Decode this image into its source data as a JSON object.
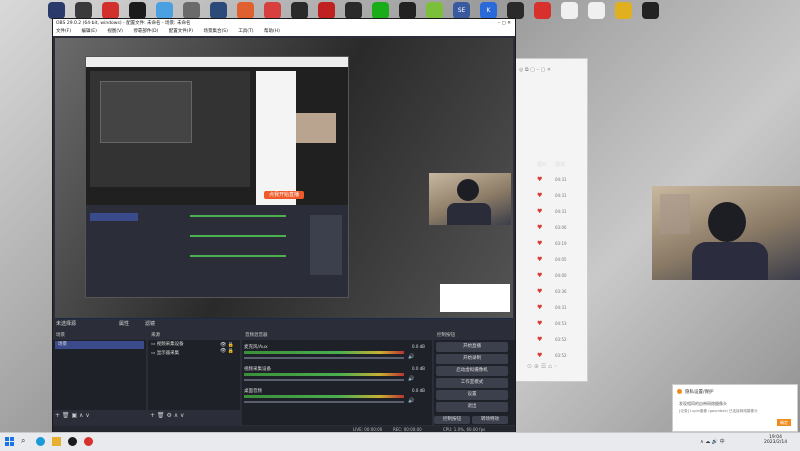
{
  "desktop": {
    "icons": [
      {
        "label": "",
        "color": "#2a3a6a"
      },
      {
        "label": "",
        "color": "#3a3a3a"
      },
      {
        "label": "",
        "color": "#d2302c"
      },
      {
        "label": "",
        "color": "#1b1b1b"
      },
      {
        "label": "",
        "color": "#4aa0e0"
      },
      {
        "label": "",
        "color": "#6a6a6a"
      },
      {
        "label": "",
        "color": "#2b4a7a"
      },
      {
        "label": "",
        "color": "#e06030"
      },
      {
        "label": "",
        "color": "#d84040"
      },
      {
        "label": "",
        "color": "#2a2a2a"
      },
      {
        "label": "",
        "color": "#c02020"
      },
      {
        "label": "",
        "color": "#2a2a2a"
      },
      {
        "label": "",
        "color": "#1aad19"
      },
      {
        "label": "",
        "color": "#222"
      },
      {
        "label": "",
        "color": "#7bbf3b"
      },
      {
        "label": "SE",
        "color": "#3a5aa0"
      },
      {
        "label": "K",
        "color": "#2a6ad8"
      },
      {
        "label": "",
        "color": "#2a2a2a"
      },
      {
        "label": "",
        "color": "#d8302c"
      },
      {
        "label": "",
        "color": "#f0f0f0"
      },
      {
        "label": "",
        "color": "#f0f0f0"
      },
      {
        "label": "",
        "color": "#e0b020"
      },
      {
        "label": "",
        "color": "#222"
      }
    ]
  },
  "obs": {
    "title": "OBS 29.0.2 (64-bit, windows) - 配置文件: 未命名 - 场景: 未命名",
    "menu": [
      "文件(F)",
      "编辑(E)",
      "视图(V)",
      "停靠部件(D)",
      "配置文件(P)",
      "场景集合(S)",
      "工具(T)",
      "帮助(H)"
    ],
    "source_toolbar": {
      "scene_label": "未选择源",
      "props": "属性",
      "filters": "滤镜"
    },
    "scenes": {
      "header": "场景",
      "items": [
        "场景"
      ]
    },
    "sources": {
      "header": "来源",
      "items": [
        "视频采集设备",
        "显示器采集"
      ]
    },
    "mixer": {
      "header": "音频混音器",
      "channels": [
        {
          "name": "麦克风/Aux",
          "db": "0.0 dB"
        },
        {
          "name": "视频采集设备",
          "db": "0.0 dB"
        },
        {
          "name": "桌面音频",
          "db": "0.0 dB"
        }
      ]
    },
    "controls": {
      "header": "控制按钮",
      "buttons": [
        "开始直播",
        "开始录制",
        "启动虚拟摄像机",
        "工作室模式",
        "设置",
        "退出"
      ],
      "bottom_tabs": [
        "控制按钮",
        "转场特效"
      ]
    },
    "status": {
      "live": "LIVE: 00:00:00",
      "rec": "REC: 00:00:00",
      "cpu": "CPU: 1.0%, 60.00 fps"
    }
  },
  "nested_preview": {
    "button": "点我开始直播"
  },
  "side_panel": {
    "col1": "图片",
    "col2": "描述",
    "rows": [
      "04:31",
      "04:31",
      "04:31",
      "03:06",
      "03:19",
      "04:05",
      "04:00",
      "03:36",
      "04:31",
      "04:53",
      "03:52",
      "03:52"
    ]
  },
  "notification": {
    "title": "隐私设置/保护",
    "line1": "发现相同的自带网络摄像头",
    "line2": "[记录] Lupin摄像 (gaumbxe) 已连接网络摄像头",
    "action": "确定"
  },
  "taskbar": {
    "time": "19:04",
    "date": "2023/2/14"
  }
}
